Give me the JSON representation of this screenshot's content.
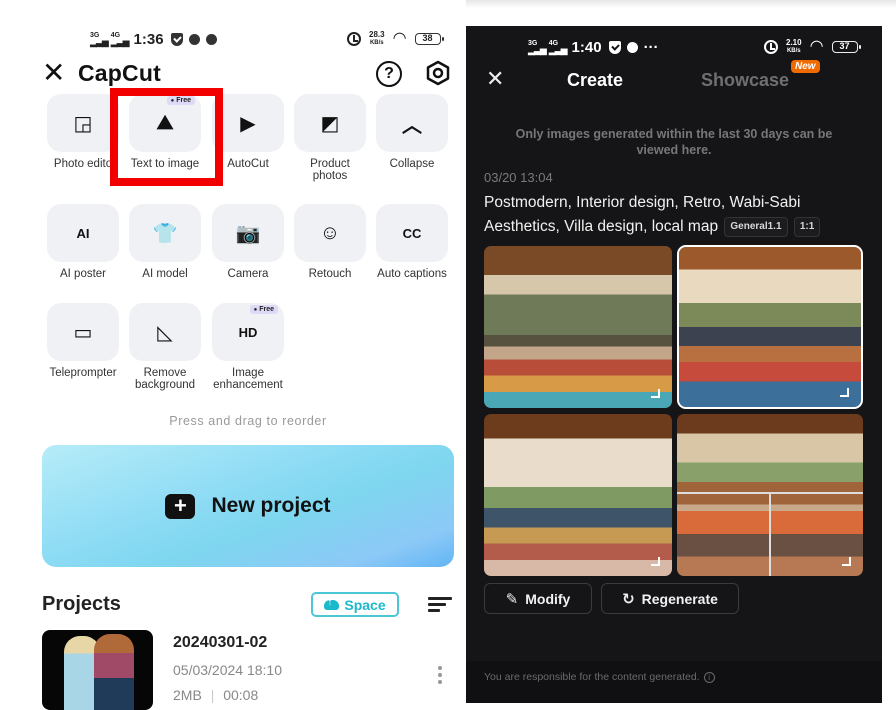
{
  "left_screen": {
    "status_bar": {
      "network_1": "3G",
      "network_2": "4G",
      "time": "1:36",
      "speed": "28.3",
      "speed_unit": "KB/s",
      "battery": "38"
    },
    "header": {
      "app_name": "CapCut",
      "help_icon": "?"
    },
    "tools": [
      {
        "label": "Photo edito",
        "icon": "photo-editor-icon",
        "glyph": "◲"
      },
      {
        "label": "Text to image",
        "icon": "text-to-image-icon",
        "glyph": "⛰",
        "badge": "Free",
        "highlighted": true
      },
      {
        "label": "AutoCut",
        "icon": "autocut-icon",
        "glyph": "▶"
      },
      {
        "label": "Product\nphotos",
        "icon": "product-photos-icon",
        "glyph": "◩"
      },
      {
        "label": "Collapse",
        "icon": "chevron-up-icon",
        "glyph": "︿"
      },
      {
        "label": "AI poster",
        "icon": "ai-poster-icon",
        "glyph": "AI"
      },
      {
        "label": "AI model",
        "icon": "ai-model-icon",
        "glyph": "👕"
      },
      {
        "label": "Camera",
        "icon": "camera-icon",
        "glyph": "📷"
      },
      {
        "label": "Retouch",
        "icon": "retouch-icon",
        "glyph": "☺"
      },
      {
        "label": "Auto captions",
        "icon": "auto-captions-icon",
        "glyph": "CC"
      },
      {
        "label": "Teleprompter",
        "icon": "teleprompter-icon",
        "glyph": "▭"
      },
      {
        "label": "Remove\nbackground",
        "icon": "remove-background-icon",
        "glyph": "◺"
      },
      {
        "label": "Image\nenhancement",
        "icon": "image-enhancement-icon",
        "glyph": "HD",
        "badge": "Free"
      }
    ],
    "reorder_hint": "Press and drag to reorder",
    "new_project_label": "New project",
    "projects_title": "Projects",
    "space_label": "Space",
    "project": {
      "name": "20240301-02",
      "date": "05/03/2024 18:10",
      "size": "2MB",
      "duration": "00:08"
    }
  },
  "right_screen": {
    "status_bar": {
      "network_1": "3G",
      "network_2": "4G",
      "time": "1:40",
      "speed": "2.10",
      "speed_unit": "KB/s",
      "battery": "37"
    },
    "tabs": [
      {
        "label": "Create",
        "active": true
      },
      {
        "label": "Showcase",
        "active": false,
        "badge": "New"
      }
    ],
    "notice": "Only images generated within the last 30 days can be viewed here.",
    "generation": {
      "date": "03/20 13:04",
      "prompt": "Postmodern, Interior design, Retro, Wabi-Sabi Aesthetics, Villa design, local map",
      "model_chip": "General1.1",
      "ratio_chip": "1:1",
      "images": [
        {
          "alt": "Living room with chandelier and patterned rug",
          "selected": false
        },
        {
          "alt": "Bedroom-living area with map wall art",
          "selected": true
        },
        {
          "alt": "Living room with arched windows and pendant lamp",
          "selected": false
        },
        {
          "alt": "Collage of open-plan living and library areas",
          "selected": false
        }
      ]
    },
    "actions": {
      "modify_label": "Modify",
      "regenerate_label": "Regenerate"
    },
    "footer_text": "You are responsible for the content generated."
  },
  "colors": {
    "highlight_border": "#f20000",
    "space_accent": "#1cb9cc",
    "new_badge": "#f06a00",
    "dark_bg": "#151517"
  }
}
